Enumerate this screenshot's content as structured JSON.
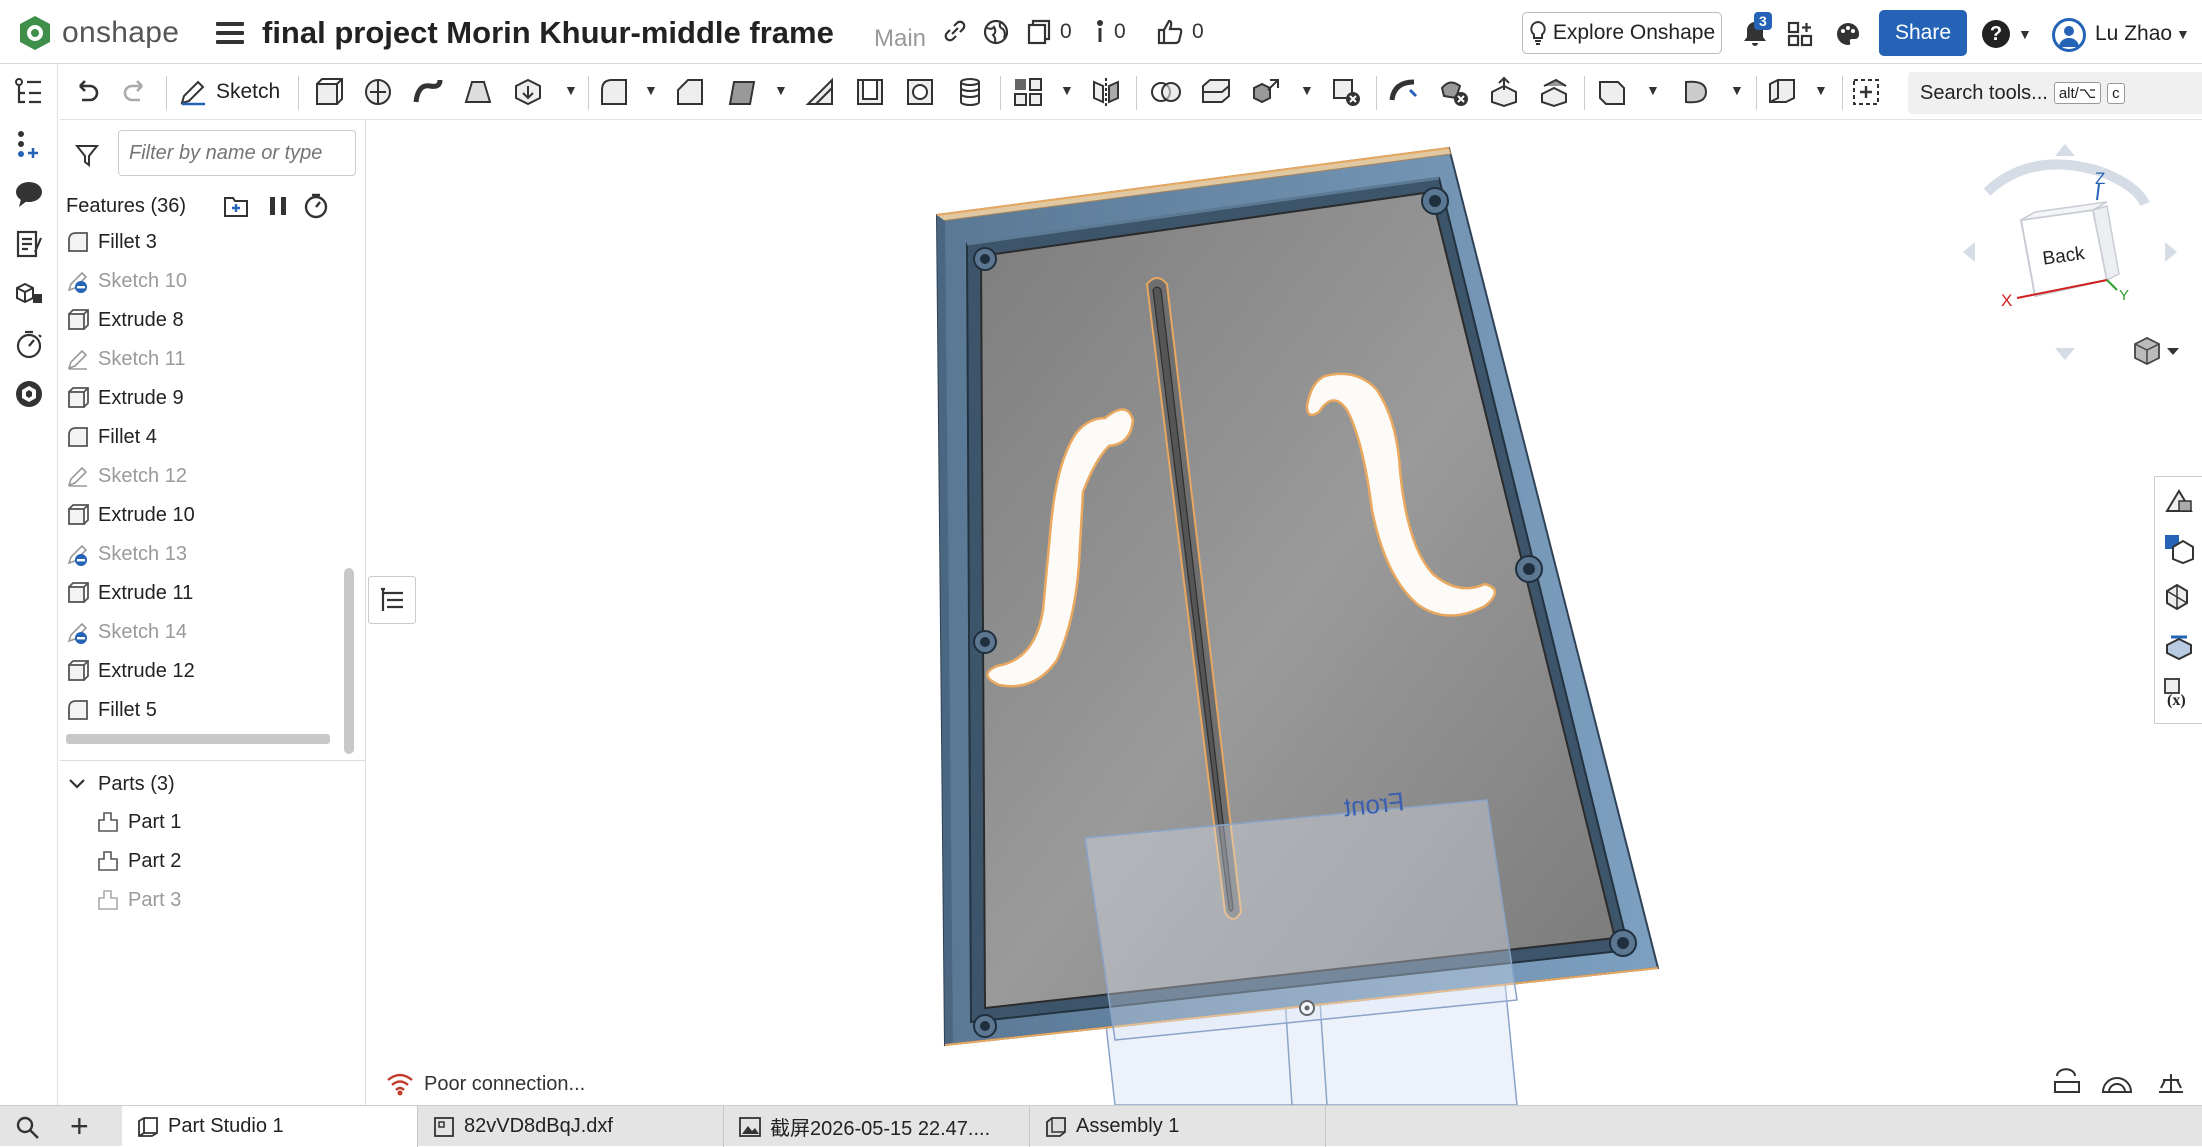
{
  "app": {
    "name": "onshape"
  },
  "document": {
    "title": "final project Morin Khuur-middle frame",
    "branch": "Main"
  },
  "header": {
    "versions_count": "0",
    "tasks_count": "0",
    "likes_count": "0",
    "explore_label": "Explore Onshape",
    "notifications_count": "3",
    "share_label": "Share",
    "help_label": "?",
    "user_name": "Lu Zhao"
  },
  "toolbar": {
    "sketch_label": "Sketch",
    "search_label": "Search tools...",
    "search_shortcut_1": "alt/⌥",
    "search_shortcut_2": "c"
  },
  "features": {
    "filter_placeholder": "Filter by name or type",
    "title": "Features (36)",
    "items": [
      {
        "label": "Fillet 3",
        "kind": "fillet",
        "dim": false
      },
      {
        "label": "Sketch 10",
        "kind": "sketch-hidden",
        "dim": true
      },
      {
        "label": "Extrude 8",
        "kind": "extrude",
        "dim": false
      },
      {
        "label": "Sketch 11",
        "kind": "sketch",
        "dim": true
      },
      {
        "label": "Extrude 9",
        "kind": "extrude",
        "dim": false
      },
      {
        "label": "Fillet 4",
        "kind": "fillet",
        "dim": false
      },
      {
        "label": "Sketch 12",
        "kind": "sketch",
        "dim": true
      },
      {
        "label": "Extrude 10",
        "kind": "extrude",
        "dim": false
      },
      {
        "label": "Sketch 13",
        "kind": "sketch-hidden",
        "dim": true
      },
      {
        "label": "Extrude 11",
        "kind": "extrude",
        "dim": false
      },
      {
        "label": "Sketch 14",
        "kind": "sketch-hidden",
        "dim": true
      },
      {
        "label": "Extrude 12",
        "kind": "extrude",
        "dim": false
      },
      {
        "label": "Fillet 5",
        "kind": "fillet",
        "dim": false
      }
    ]
  },
  "parts": {
    "title": "Parts (3)",
    "items": [
      {
        "label": "Part 1",
        "dim": false
      },
      {
        "label": "Part 2",
        "dim": false
      },
      {
        "label": "Part 3",
        "dim": true
      }
    ]
  },
  "viewport": {
    "view_cube_face": "Back",
    "axis_x": "X",
    "axis_y": "Y",
    "axis_z": "Z",
    "plane_label": "Front",
    "status_text": "Poor connection...",
    "colors": {
      "part_fill": "#8a8a8a",
      "frame": "#6d8fae",
      "plane": "#dfe8f5",
      "highlight": "#e8a860"
    }
  },
  "tabs": [
    {
      "label": "Part Studio 1",
      "active": true
    },
    {
      "label": "82vVD8dBqJ.dxf",
      "active": false
    },
    {
      "label": "截屏2026-05-15 22.47....",
      "active": false
    },
    {
      "label": "Assembly 1",
      "active": false
    }
  ]
}
